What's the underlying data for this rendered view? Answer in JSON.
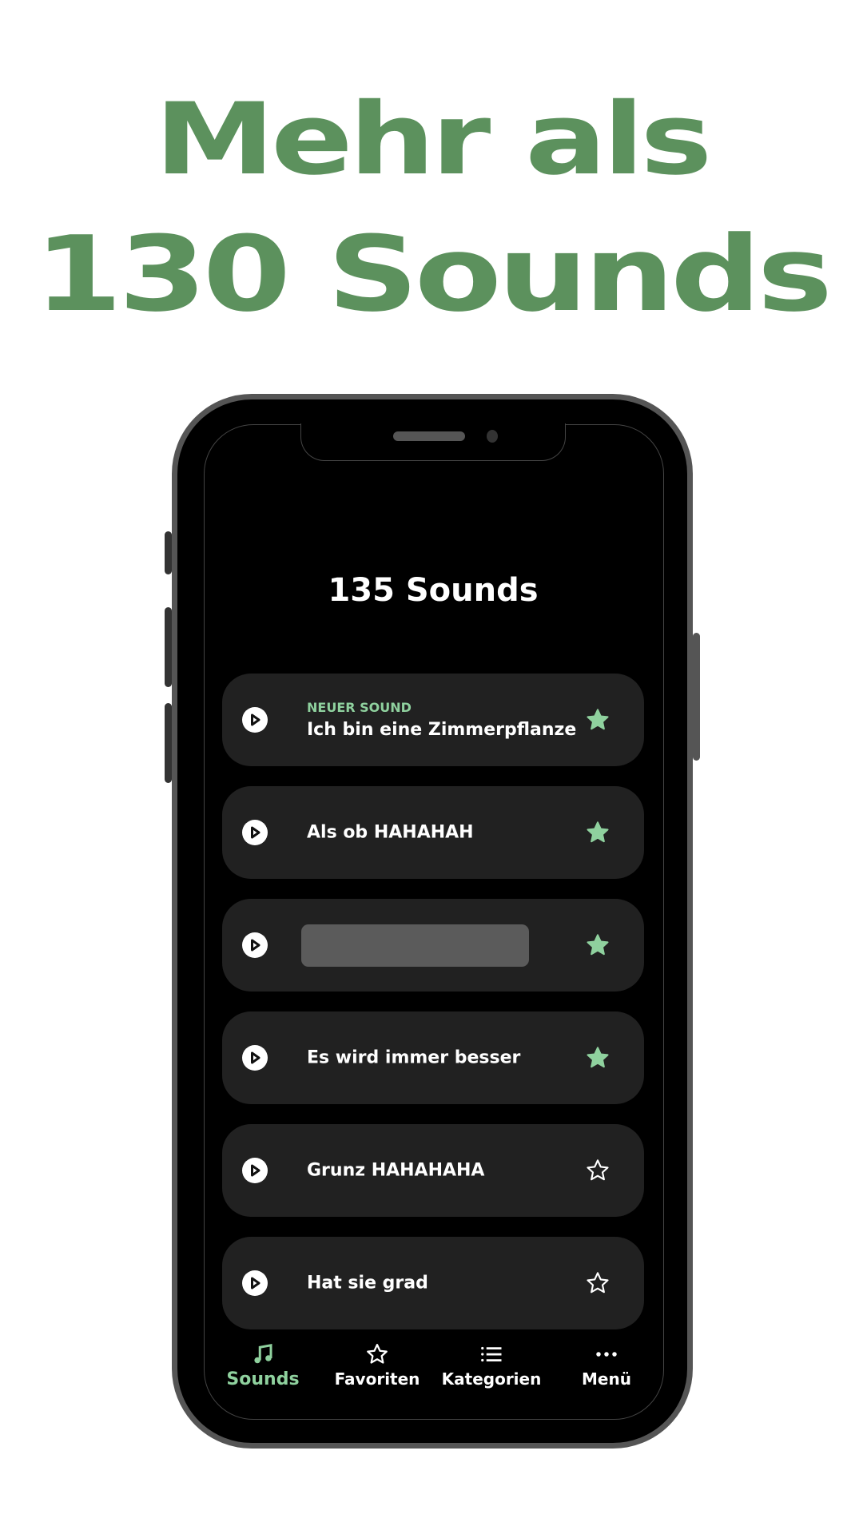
{
  "promo": {
    "headline_line1": "Mehr als",
    "headline_line2": "130 Sounds",
    "accent_color": "#5c915d"
  },
  "app": {
    "title": "135 Sounds",
    "accent_color": "#8fd19e",
    "sounds": [
      {
        "badge": "NEUER SOUND",
        "title": "Ich bin eine Zimmerpflanze",
        "favorite": true,
        "icon": "play-icon"
      },
      {
        "badge": "",
        "title": "Als ob HAHAHAH",
        "favorite": true,
        "icon": "play-icon"
      },
      {
        "badge": "",
        "title": "",
        "favorite": true,
        "icon": "play-icon",
        "redacted": true
      },
      {
        "badge": "",
        "title": "Es wird immer besser",
        "favorite": true,
        "icon": "play-icon"
      },
      {
        "badge": "",
        "title": "Grunz HAHAHAHA",
        "favorite": false,
        "icon": "play-icon"
      },
      {
        "badge": "",
        "title": "Hat sie grad",
        "favorite": false,
        "icon": "play-icon"
      }
    ],
    "tabs": [
      {
        "label": "Sounds",
        "icon": "music-note-icon",
        "active": true
      },
      {
        "label": "Favoriten",
        "icon": "star-outline-icon",
        "active": false
      },
      {
        "label": "Kategorien",
        "icon": "list-icon",
        "active": false
      },
      {
        "label": "Menü",
        "icon": "more-dots-icon",
        "active": false
      }
    ]
  }
}
